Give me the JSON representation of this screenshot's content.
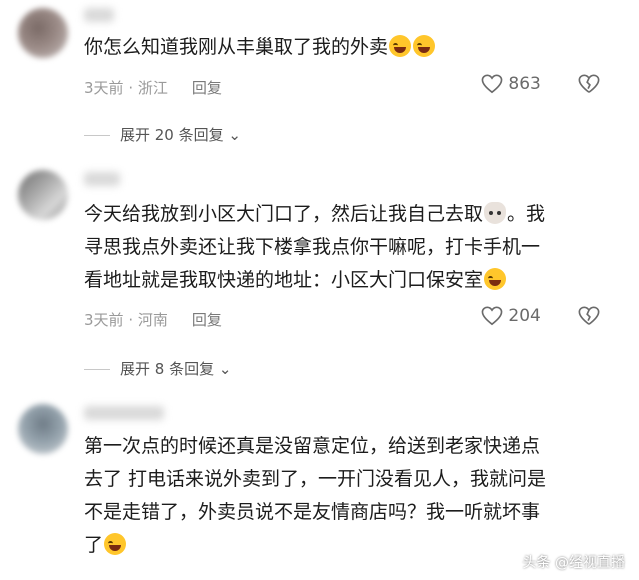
{
  "comments": [
    {
      "lines": [
        "你怎么知道我刚从丰巢取了我的外卖"
      ],
      "emoji_end": [
        "laughing-crying-emoji",
        "laughing-crying-emoji"
      ],
      "time": "3天前",
      "location": "浙江",
      "reply_label": "回复",
      "likes": "863",
      "expand_label": "展开 20 条回复"
    },
    {
      "lines": [
        "今天给我放到小区大门口了，然后让我自己去取",
        "。我",
        "寻思我点外卖还让我下楼拿我点你干嘛呢，打卡手机一",
        "看地址就是我取快递的地址：小区大门口保安室"
      ],
      "emoji_inline": "cat-emoji",
      "emoji_end": [
        "laughing-crying-emoji"
      ],
      "time": "3天前",
      "location": "河南",
      "reply_label": "回复",
      "likes": "204",
      "expand_label": "展开 8 条回复"
    },
    {
      "lines": [
        "第一次点的时候还真是没留意定位，给送到老家快递点",
        "去了 打电话来说外卖到了，一开门没看见人，我就问是",
        "不是走错了，外卖员说不是友情商店吗？我一听就坏事",
        "了"
      ],
      "emoji_end": [
        "laughing-crying-emoji"
      ]
    }
  ],
  "watermark": "头条 @经视直播",
  "colors": {
    "text": "#1c1c1c",
    "meta": "#9a9a9a",
    "background": "#ffffff"
  }
}
